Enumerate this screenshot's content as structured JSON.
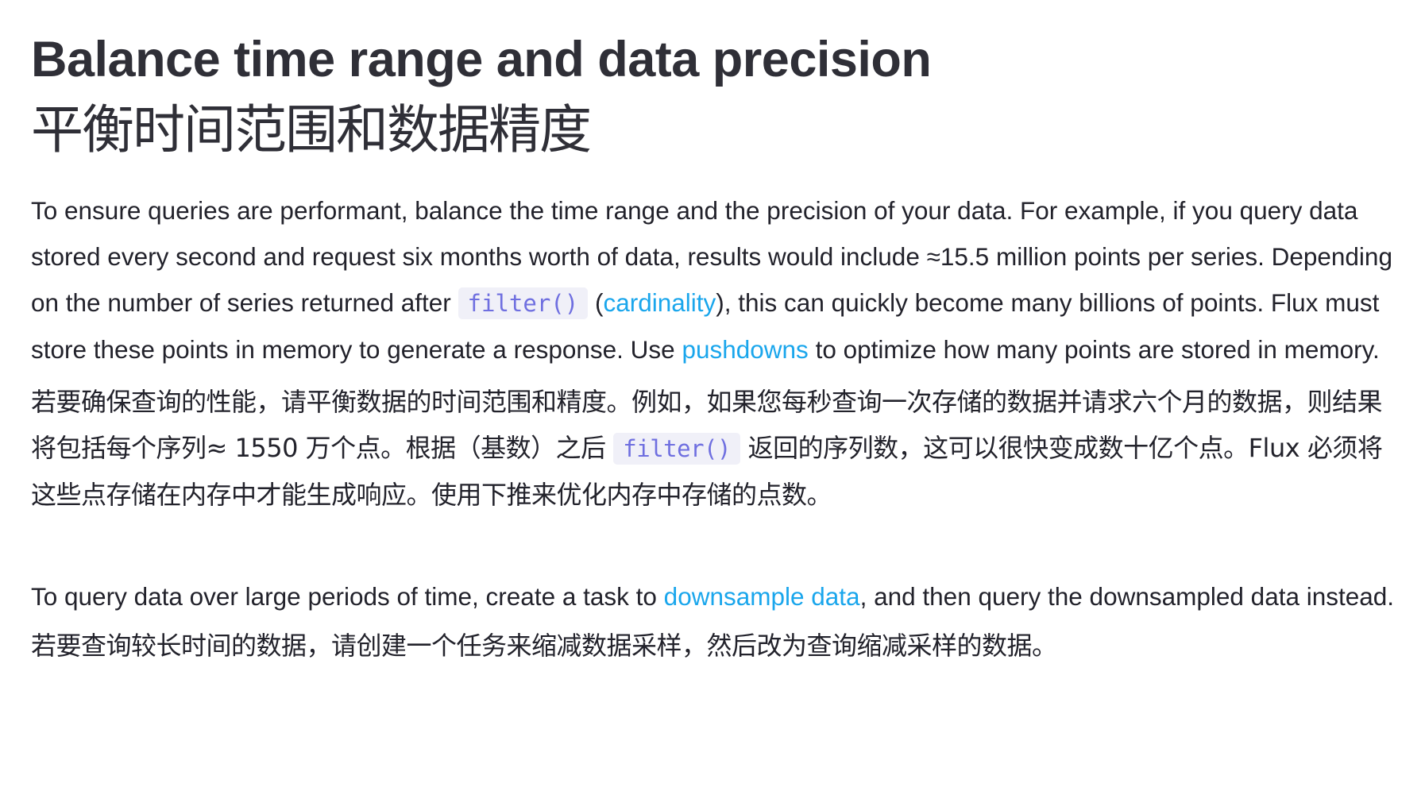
{
  "heading": {
    "title_en": "Balance time range and data precision",
    "title_zh": "平衡时间范围和数据精度"
  },
  "paragraph1": {
    "en_part1": "To ensure queries are performant, balance the time range and the precision of your data. For example, if you query data stored every second and request six months worth of data, results would include ≈15.5 million points per series. Depending on the number of series returned after ",
    "en_code": "filter()",
    "en_part2": " (",
    "en_link_cardinality": "cardinality",
    "en_part3": "), this can quickly become many billions of points. Flux must store these points in memory to generate a response. Use ",
    "en_link_pushdowns": "pushdowns",
    "en_part4": " to optimize how many points are stored in memory.",
    "zh_part1": "若要确保查询的性能，请平衡数据的时间范围和精度。例如，如果您每秒查询一次存储的数据并请求六个月的数据，则结果将包括每个序列≈ 1550 万个点。根据（基数）之后 ",
    "zh_code": "filter()",
    "zh_part2": " 返回的序列数，这可以很快变成数十亿个点。Flux 必须将这些点存储在内存中才能生成响应。使用下推来优化内存中存储的点数。"
  },
  "paragraph2": {
    "en_part1": "To query data over large periods of time, create a task to ",
    "en_link_downsample": "downsample data",
    "en_part2": ", and then query the downsampled data instead.",
    "zh_text": "若要查询较长时间的数据，请创建一个任务来缩减数据采样，然后改为查询缩减采样的数据。"
  },
  "colors": {
    "text": "#22222b",
    "heading": "#2f2f37",
    "link": "#1aa6ec",
    "code_text": "#6f6fe0",
    "code_bg": "#f0f0f8"
  }
}
